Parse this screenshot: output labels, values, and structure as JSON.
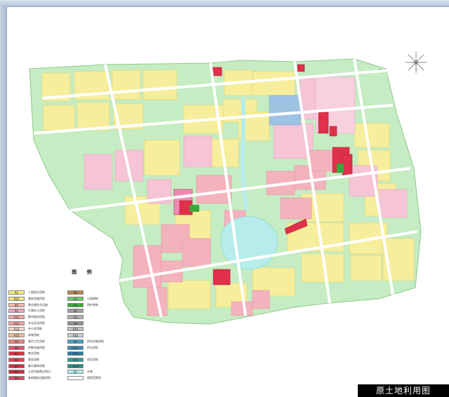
{
  "map_title": "原土地利用图",
  "legend": {
    "title": "图 例",
    "left": [
      {
        "code": "R2",
        "label": "二类居住用地",
        "color": "#f5ee79"
      },
      {
        "code": "R22",
        "label": "服务设施用地",
        "color": "#f3e67a"
      },
      {
        "code": "B9",
        "label": "商业服务业设施",
        "color": "#f4b8a6"
      },
      {
        "code": "A1",
        "label": "行政办公用地",
        "color": "#f0a0b4"
      },
      {
        "code": "A21",
        "label": "图书展览用地",
        "color": "#f6a6a6"
      },
      {
        "code": "A22",
        "label": "文化活动用地",
        "color": "#f2a0a0"
      },
      {
        "code": "A33",
        "label": "中小学用地",
        "color": "#f5d4c8"
      },
      {
        "code": "A41",
        "label": "体育用地",
        "color": "#f0c090"
      },
      {
        "code": "A5",
        "label": "医疗卫生用地",
        "color": "#f08080"
      },
      {
        "code": "A9",
        "label": "宗教设施用地",
        "color": "#e05070"
      },
      {
        "code": "B1",
        "label": "商业用地",
        "color": "#e03040"
      },
      {
        "code": "B2",
        "label": "商务用地",
        "color": "#e0405a"
      },
      {
        "code": "B3",
        "label": "娱乐康体用地",
        "color": "#d03048"
      },
      {
        "code": "B4",
        "label": "公用设施营业网点",
        "color": "#c83040"
      },
      {
        "code": "B9",
        "label": "其他服务设施用地",
        "color": "#d05060"
      }
    ],
    "right": [
      {
        "code": "M1",
        "label": "",
        "color": "#b8864a"
      },
      {
        "code": "G1",
        "label": "公园绿地",
        "color": "#6cc86c"
      },
      {
        "code": "G2",
        "label": "防护绿地",
        "color": "#3aa83a"
      },
      {
        "code": "S1",
        "label": "",
        "color": "#a0a0a0"
      },
      {
        "code": "S3",
        "label": "",
        "color": "#b0b0b0"
      },
      {
        "code": "S4",
        "label": "",
        "color": "#909090"
      },
      {
        "code": "S41",
        "label": "",
        "color": "#c0c0c0"
      },
      {
        "code": "S42",
        "label": "",
        "color": "#cccccc"
      },
      {
        "code": "U1",
        "label": "供应设施用地",
        "color": "#4a9ac8"
      },
      {
        "code": "U11",
        "label": "供水用地",
        "color": "#3a8ab8"
      },
      {
        "code": "U12",
        "label": "",
        "color": "#2a7aa8"
      },
      {
        "code": "U21",
        "label": "排水用地",
        "color": "#3a9a98"
      },
      {
        "code": "U22",
        "label": "",
        "color": "#2a8a88"
      },
      {
        "code": "E1",
        "label": "水域",
        "color": "#b0ecec"
      },
      {
        "code": "",
        "label": "规划范围线",
        "color": "#ffffff"
      }
    ]
  },
  "colors": {
    "residential": "#f5ee9a",
    "residential_strong": "#f1e27a",
    "commercial_pink": "#f3b7c0",
    "admin_pink": "#f6c6d8",
    "school": "#f7d9e6",
    "red": "#e0304a",
    "green": "#b8eab0",
    "green_dark": "#3aa83a",
    "water": "#b6ecec",
    "road": "#ffffff",
    "gov_blue": "#9ec4e4",
    "grey": "#c8c8c8"
  }
}
